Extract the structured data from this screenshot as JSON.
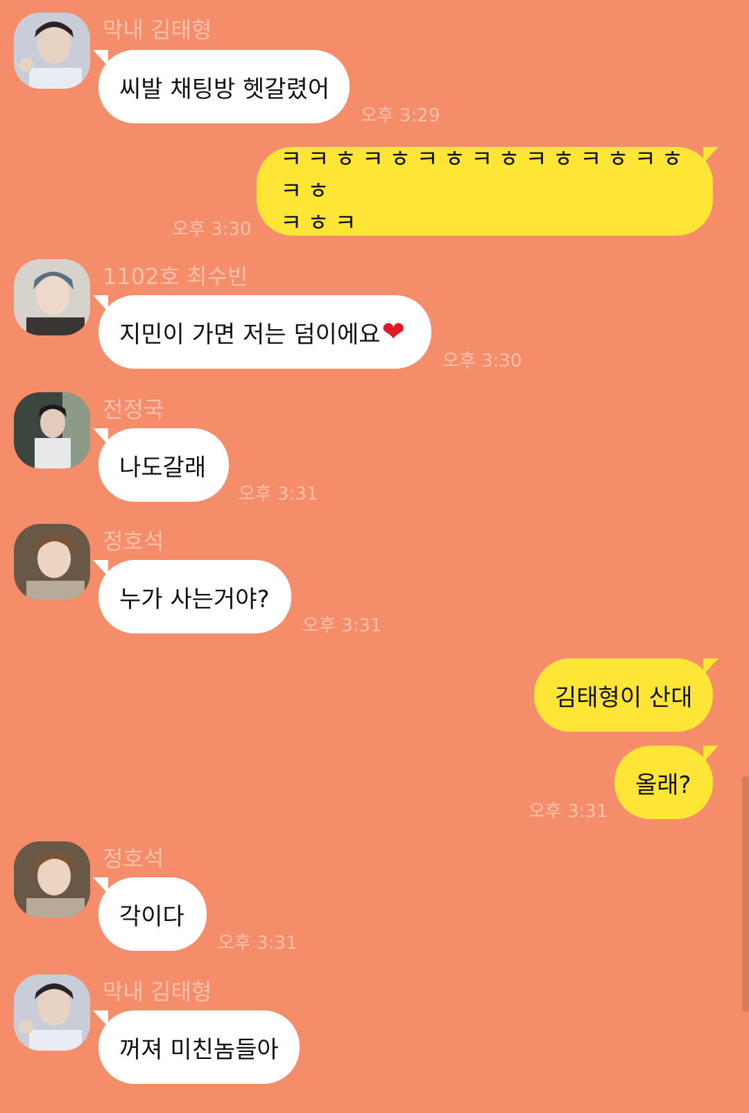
{
  "messages": [
    {
      "sender": "막내 김태형",
      "text": "씨발 채팅방 헷갈렸어",
      "time": "오후 3:29"
    },
    {
      "text": "ㅋㅋㅎㅋㅎㅋㅎㅋㅎㅋㅎㅋㅎㅋㅎㅋㅎ\nㅋㅎㅋ",
      "time": "오후 3:30"
    },
    {
      "sender": "1102호 최수빈",
      "text": "지민이 가면 저는 덤이에요",
      "emoji": "❤",
      "time": "오후 3:30"
    },
    {
      "sender": "전정국",
      "text": "나도갈래",
      "time": "오후 3:31"
    },
    {
      "sender": "정호석",
      "text": "누가 사는거야?",
      "time": "오후 3:31"
    },
    {
      "text": "김태형이 산대"
    },
    {
      "text": "올래?",
      "time": "오후 3:31"
    },
    {
      "sender": "정호석",
      "text": "각이다",
      "time": "오후 3:31"
    },
    {
      "sender": "막내 김태형",
      "text": "꺼져 미친놈들아"
    }
  ],
  "colors": {
    "background": "#f58d6b",
    "incoming_bubble": "#ffffff",
    "outgoing_bubble": "#fee536",
    "meta_text": "#fbc2ad"
  }
}
